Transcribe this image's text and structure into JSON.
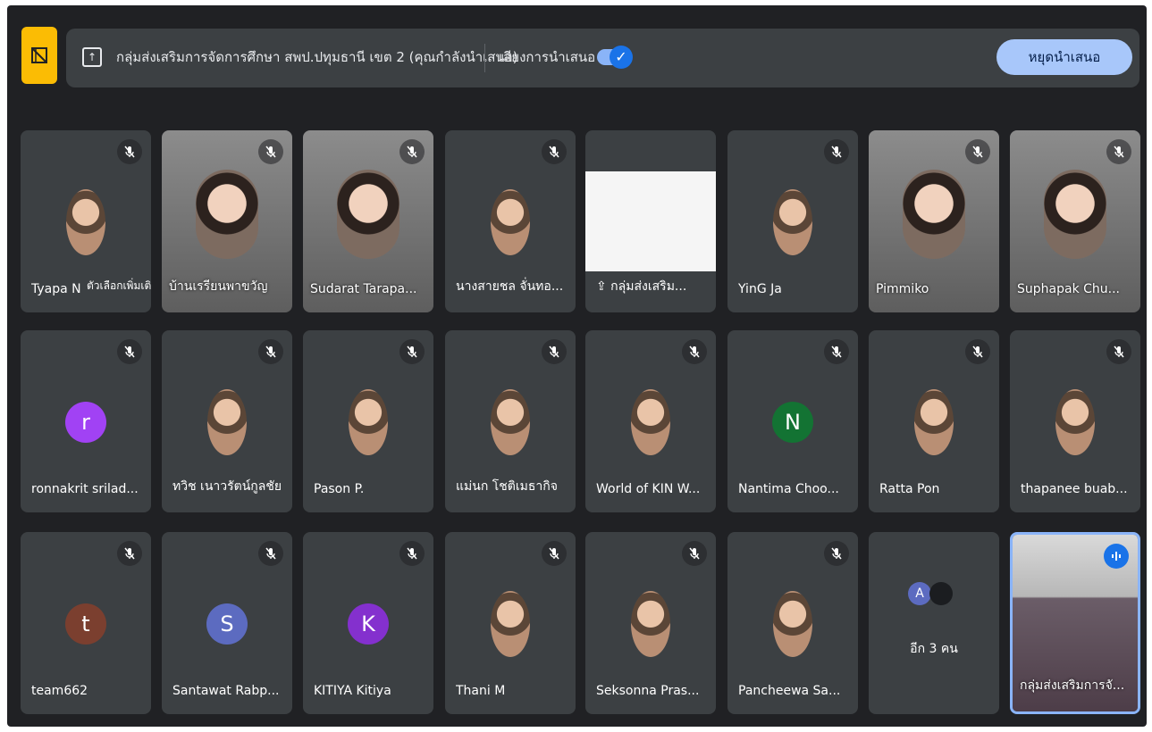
{
  "presentation": {
    "banner": "กลุ่มส่งเสริมการจัดการศึกษา สพป.ปทุมธานี เขต 2 (คุณกำลังนำเสนอ)",
    "audio_label": "เสียงการนำเสนอ",
    "audio_enabled": true,
    "stop_label": "หยุดนำเสนอ",
    "accent": "#fbbc04"
  },
  "tiles": [
    {
      "name": "Tyapa N",
      "extra": "ตัวเลือกเพิ่มเติม",
      "kind": "photo",
      "muted": true
    },
    {
      "name": "บ้านเรรียนพาขวัญ",
      "kind": "video",
      "muted": true
    },
    {
      "name": "Sudarat Tarapa...",
      "kind": "video",
      "muted": true
    },
    {
      "name": "นางสายชล จั่นทอ...",
      "kind": "photo",
      "muted": true
    },
    {
      "name": "กลุ่มส่งเสริม...",
      "kind": "screen",
      "muted": false
    },
    {
      "name": "YinG Ja",
      "kind": "photo",
      "muted": true
    },
    {
      "name": "Pimmiko",
      "kind": "video",
      "muted": true
    },
    {
      "name": "Suphapak Chu...",
      "kind": "video",
      "muted": true
    },
    {
      "name": "ronnakrit srilad...",
      "kind": "letter",
      "letter": "r",
      "color": "#a142f4",
      "muted": true
    },
    {
      "name": "ทวิช เนาวรัตน์กูลชัย",
      "kind": "photo",
      "muted": true
    },
    {
      "name": "Pason P.",
      "kind": "photo",
      "muted": true
    },
    {
      "name": "แม่นก โชติเมธากิจ",
      "kind": "photo",
      "muted": true
    },
    {
      "name": "World of KIN W...",
      "kind": "photo",
      "muted": true
    },
    {
      "name": "Nantima Choo...",
      "kind": "letter",
      "letter": "N",
      "color": "#137333",
      "muted": true
    },
    {
      "name": "Ratta Pon",
      "kind": "photo",
      "muted": true
    },
    {
      "name": "thapanee buab...",
      "kind": "photo",
      "muted": true
    },
    {
      "name": "team662",
      "kind": "letter",
      "letter": "t",
      "color": "#7b3f2f",
      "muted": true
    },
    {
      "name": "Santawat Rabp...",
      "kind": "letter",
      "letter": "S",
      "color": "#5c6bc0",
      "muted": true
    },
    {
      "name": "KITIYA Kitiya",
      "kind": "letter",
      "letter": "K",
      "color": "#8430ce",
      "muted": true
    },
    {
      "name": "Thani M",
      "kind": "photo",
      "muted": true
    },
    {
      "name": "Seksonna Pras...",
      "kind": "photo",
      "muted": true
    },
    {
      "name": "Pancheewa Sa...",
      "kind": "photo",
      "muted": true
    },
    {
      "name": "อีก 3 คน",
      "kind": "more",
      "letter": "A",
      "muted": false
    },
    {
      "name": "กลุ่มส่งเสริมการจั...",
      "kind": "active",
      "muted": false
    }
  ]
}
